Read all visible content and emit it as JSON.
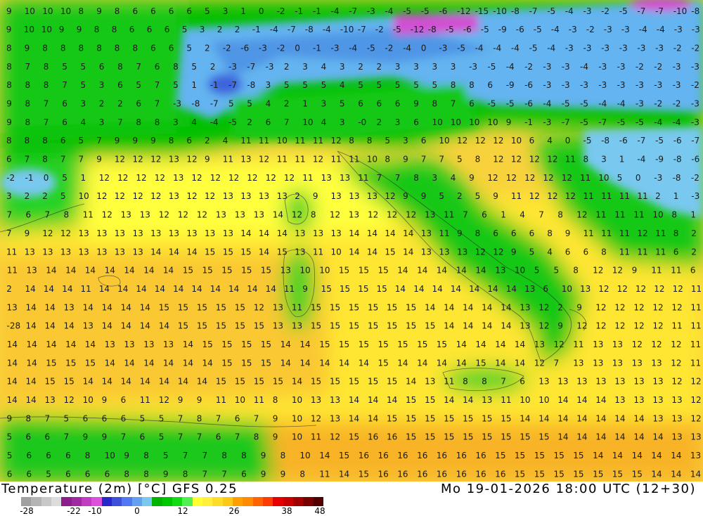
{
  "title": {
    "left": "Temperature (2m) [°C] GFS 0.25",
    "right": "Mo 19-01-2026 18:00 UTC (12+30)"
  },
  "colorbar": {
    "colors": [
      "#a0a0a0",
      "#b4b4b4",
      "#c8c8c8",
      "#dcdcdc",
      "#8c1e8c",
      "#a028a0",
      "#c03cc0",
      "#dc50dc",
      "#2828c8",
      "#3c50dc",
      "#5078f0",
      "#64a0f0",
      "#78c8f0",
      "#00b400",
      "#00c800",
      "#14dc14",
      "#50f050",
      "#ffff32",
      "#fff03c",
      "#ffdc28",
      "#ffc814",
      "#ffa000",
      "#ff8c00",
      "#ff6400",
      "#ff3c00",
      "#e60000",
      "#c80000",
      "#a00000",
      "#780000",
      "#500000"
    ],
    "tick_labels": [
      "-28",
      "-22",
      "-10",
      "0",
      "12",
      "26",
      "38",
      "48"
    ]
  },
  "map": {
    "rows": [
      "9 10 10 10 8 9 8 6 6 6 6 5 3 1 0 -2 -1 -1 -4 -7 -3 -4 -5 -5 -6 -12 -15 -10 -8 -7 -5 -4 -3 -2 -5 -7 -7 -10 -8",
      "9 10 10 9 9 8 8 6 6 6 5 3 2 2 -1 -4 -7 -8 -4 -10 -7 -2 -5 -12 -8 -5 -6 -5 -9 -6 -5 -4 -3 -2 -3 -3 -4 -4 -3 -3",
      "8 9 8 8 8 8 8 8 6 6 5 2 -2 -6 -3 -2 0 -1 -3 -4 -5 -2 -4 0 -3 -5 -4 -4 -4 -5 -4 -3 -3 -3 -3 -3 -3 -2 -2",
      "8 7 8 5 5 6 8 7 6 8 5 2 -3 -7 -3 2 3 4 3 2 2 3 3 3 3 -3 -5 -4 -2 -3 -3 -4 -3 -3 -2 -2 -3 -3",
      "8 8 8 7 5 3 6 5 7 5 1 -1 -7 -8 3 5 5 5 4 5 5 5 5 5 8 8 6 -9 -6 -3 -3 -3 -3 -3 -3 -3 -3 -2",
      "9 8 7 6 3 2 2 6 7 -3 -8 -7 5 5 4 2 1 3 5 6 6 6 9 8 7 6 -5 -5 -6 -4 -5 -5 -4 -4 -3 -2 -2 -3",
      "9 8 7 6 4 3 7 8 8 3 4 -4 -5 2 6 7 10 4 3 -0 2 3 6 10 10 10 10 9 -1 -3 -7 -5 -7 -5 -5 -4 -4 -3",
      "8 8 8 6 5 7 9 9 9 8 6 2 4 11 11 10 11 11 12 8 8 5 3 6 10 12 12 12 10 6 4 0 -5 -8 -6 -7 -5 -6 -7",
      "6 7 8 7 7 9 12 12 12 13 12 9 11 13 12 11 11 12 11 11 10 8 9 7 7 5 8 12 12 12 12 11 8 3 1 -4 -9 -8 -6",
      "-2 -1 0 5 1 12 12 12 12 13 12 12 12 12 12 12 11 13 13 11 7 7 8 3 4 9 12 12 12 12 12 11 10 5 0 -3 -8 -2",
      "3 2 2 5 10 12 12 12 12 13 12 12 13 13 13 13 2 9 13 13 13 12 9 9 5 2 5 9 11 12 12 12 11 11 11 11 2 1 -3",
      "7 6 7 8 11 12 13 13 12 12 12 13 13 13 14 12 8 12 13 12 12 12 13 11 7 6 1 4 7 8 12 11 11 11 10 8 1",
      "7 9 12 12 13 13 13 13 13 13 13 13 13 14 14 14 13 13 13 14 14 14 14 13 11 9 8 6 6 6 8 9 11 11 11 12 11 8 2",
      "11 13 13 13 13 13 13 13 14 14 14 15 15 15 14 15 13 11 10 14 14 15 14 13 13 13 12 12 9 5 4 6 6 8 11 11 11 6 2",
      "11 13 14 14 14 14 14 14 14 15 15 15 15 15 13 10 10 15 15 15 14 14 14 14 14 13 10 5 5 8 12 12 9 11 11 6",
      "2 14 14 14 11 14 14 14 14 14 14 14 14 14 14 11 9 15 15 15 15 14 14 14 14 14 14 14 13 6 10 13 12 12 12 12 12 11",
      "13 14 14 13 14 14 14 14 15 15 15 15 15 12 13 11 15 15 15 15 15 15 14 14 14 14 14 13 12 2 9 12 12 12 12 12 11",
      "-28 14 14 14 13 14 14 14 14 15 15 15 15 15 13 13 15 15 15 15 15 15 15 14 14 14 14 13 12 9 12 12 12 12 12 11 11",
      "14 14 14 14 14 13 13 13 13 14 15 15 15 15 14 14 15 15 15 15 15 15 15 14 14 14 14 13 12 11 13 13 12 12 12 11",
      "14 14 15 15 15 14 14 14 14 14 14 15 15 15 14 14 14 14 14 15 14 14 14 14 15 14 14 12 7 13 13 13 13 13 12 11",
      "14 14 15 15 14 14 14 14 14 14 14 15 15 15 15 14 15 15 15 15 15 14 13 11 8 8 7 6 13 13 13 13 13 13 13 12 12",
      "14 14 13 12 10 9 6 11 12 9 9 11 10 11 8 10 13 13 14 14 14 15 15 14 14 13 11 10 10 14 14 14 13 13 13 13 12",
      "9 8 7 5 6 6 6 5 5 7 8 7 6 7 9 10 12 13 14 14 15 15 15 15 15 15 15 14 14 14 14 14 14 14 13 13 12",
      "5 6 6 7 9 9 7 6 5 7 7 6 7 8 9 10 11 12 15 16 16 15 15 15 15 15 15 15 15 14 14 14 14 14 14 13 13",
      "5 6 6 6 8 10 9 8 5 7 7 8 8 9 8 10 14 15 16 16 16 16 16 16 16 15 15 15 15 15 14 14 14 14 14 13",
      "6 6 5 6 6 6 8 8 9 8 7 7 6 9 9 8 11 14 15 16 16 16 16 16 16 16 15 15 15 15 15 15 15 14 14 14"
    ]
  }
}
